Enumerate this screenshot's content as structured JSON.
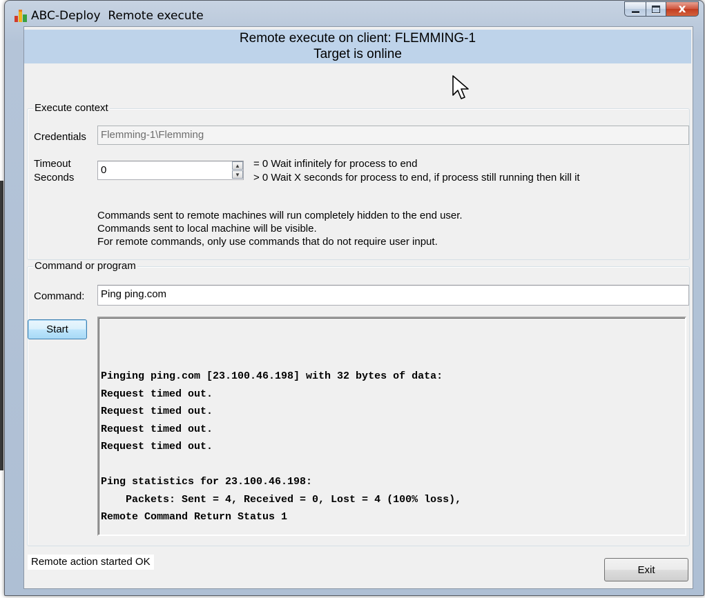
{
  "window": {
    "app_name": "ABC-Deploy",
    "title": "Remote execute",
    "close_glyph": "x"
  },
  "banner": {
    "line1": "Remote execute on client: FLEMMING-1",
    "line2": "Target is online"
  },
  "execute_context": {
    "legend": "Execute context",
    "credentials_label": "Credentials",
    "credentials_value": "Flemming-1\\Flemming",
    "timeout_label_1": "Timeout",
    "timeout_label_2": "Seconds",
    "timeout_value": "0",
    "timeout_help_1": "= 0 Wait infinitely for process to end",
    "timeout_help_2": "> 0 Wait X seconds for process to end, if process still running then kill it",
    "note_1": "Commands sent to remote machines will run completely hidden to the end user.",
    "note_2": "Commands sent to local machine will be visible.",
    "note_3": "For remote commands, only use commands that do not require user input."
  },
  "command_group": {
    "legend": "Command or program",
    "command_label": "Command:",
    "command_value": "Ping ping.com",
    "start_label": "Start",
    "output_lines": [
      "Pinging ping.com [23.100.46.198] with 32 bytes of data:",
      "Request timed out.",
      "Request timed out.",
      "Request timed out.",
      "Request timed out.",
      "",
      "Ping statistics for 23.100.46.198:",
      "    Packets: Sent = 4, Received = 0, Lost = 4 (100% loss),",
      "Remote Command Return Status 1"
    ]
  },
  "status": {
    "text": "Remote action started OK"
  },
  "exit_label": "Exit",
  "icons": {
    "app": "abc-deploy-app-icon",
    "minimize": "minimize-icon",
    "maximize": "maximize-icon",
    "close": "close-icon",
    "spin_up": "spin-up-icon",
    "spin_down": "spin-down-icon",
    "cursor": "mouse-cursor-icon"
  },
  "colors": {
    "banner": "#bed3ea",
    "close_button": "#c8452a",
    "dialog_bg": "#f0f0f0"
  }
}
